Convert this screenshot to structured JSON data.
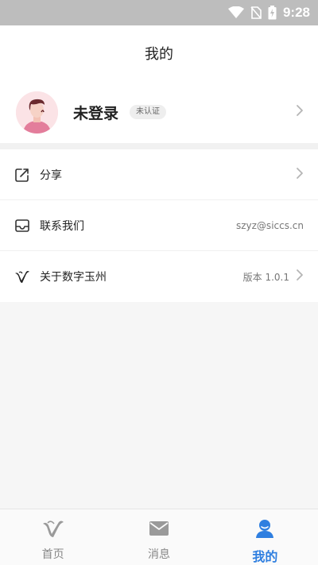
{
  "status_bar": {
    "time": "9:28"
  },
  "header": {
    "title": "我的"
  },
  "profile": {
    "name": "未登录",
    "badge": "未认证"
  },
  "menu": [
    {
      "label": "分享",
      "value": "",
      "icon": "share-icon"
    },
    {
      "label": "联系我们",
      "value": "szyz@siccs.cn",
      "icon": "mail-icon"
    },
    {
      "label": "关于数字玉州",
      "value": "版本 1.0.1",
      "icon": "app-logo-icon"
    }
  ],
  "tabs": [
    {
      "label": "首页",
      "icon": "home-logo-icon",
      "active": false
    },
    {
      "label": "消息",
      "icon": "message-icon",
      "active": false
    },
    {
      "label": "我的",
      "icon": "profile-icon",
      "active": true
    }
  ],
  "colors": {
    "accent": "#2f7fe0",
    "status_bar": "#bdbdbd"
  }
}
